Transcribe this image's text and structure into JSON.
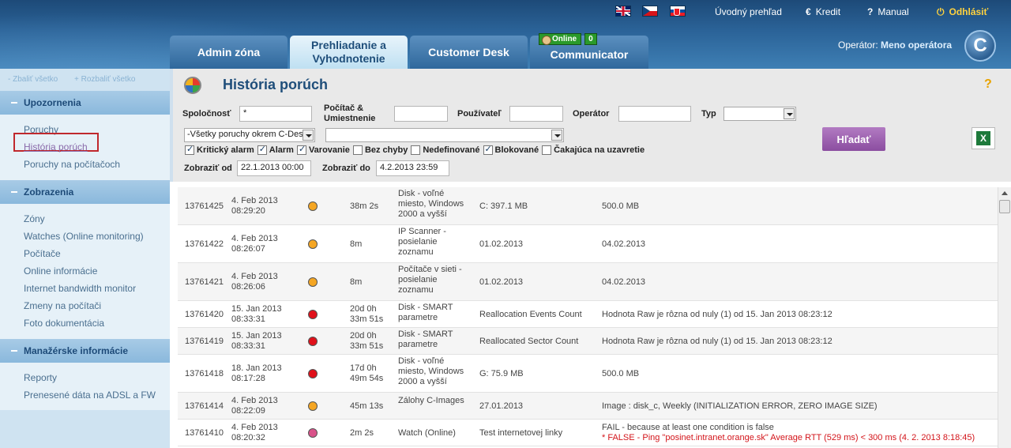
{
  "header": {
    "flags": [
      "uk-flag",
      "cz-flag",
      "sk-flag"
    ],
    "links": {
      "home": "Úvodný prehľad",
      "credit": "Kredit",
      "manual": "Manual",
      "logout": "Odhlásiť"
    },
    "tabs": [
      {
        "label": "Admin zóna"
      },
      {
        "label": "Prehliadanie a Vyhodnotenie",
        "active": true
      },
      {
        "label": "Customer Desk"
      },
      {
        "label": "Communicator"
      }
    ],
    "online": {
      "label": "Online",
      "count": "0"
    },
    "operator_label": "Operátor:",
    "operator_name": "Meno operátora",
    "logo": "C"
  },
  "sidebar": {
    "collapse_all": "- Zbaliť všetko",
    "expand_all": "+ Rozbaliť všetko",
    "sections": [
      {
        "title": "Upozornenia",
        "items": [
          "Poruchy",
          "História porúch",
          "Poruchy na počítačoch"
        ]
      },
      {
        "title": "Zobrazenia",
        "items": [
          "Zóny",
          "Watches (Online monitoring)",
          "Počítače",
          "Online informácie",
          "Internet bandwidth monitor",
          "Zmeny na počítači",
          "Foto dokumentácia"
        ]
      },
      {
        "title": "Manažérske informácie",
        "items": [
          "Reporty",
          "Prenesené dáta na ADSL a FW"
        ]
      }
    ],
    "current_item": "História porúch"
  },
  "page": {
    "title": "História porúch",
    "help": "?"
  },
  "filters": {
    "company_label": "Spoločnosť",
    "company_value": "*",
    "computer_label": "Počítač & Umiestnenie",
    "user_label": "Používateľ",
    "operator_label": "Operátor",
    "type_label": "Typ",
    "type_select": "-Všetky poruchy okrem C-Desk",
    "checkboxes": [
      {
        "label": "Kritický alarm",
        "checked": true
      },
      {
        "label": "Alarm",
        "checked": true
      },
      {
        "label": "Varovanie",
        "checked": true
      },
      {
        "label": "Bez chyby",
        "checked": false
      },
      {
        "label": "Nedefinované",
        "checked": false
      },
      {
        "label": "Blokované",
        "checked": true
      },
      {
        "label": "Čakajúca na uzavretie",
        "checked": false
      }
    ],
    "from_label": "Zobraziť od",
    "from_value": "22.1.2013 00:00",
    "to_label": "Zobraziť do",
    "to_value": "4.2.2013 23:59",
    "search_button": "Hľadať",
    "export_icon": "excel-icon"
  },
  "status_colors": {
    "orange": "#f5a623",
    "red": "#e0101a",
    "pink": "#d9528a"
  },
  "rows": [
    {
      "id": "13761425",
      "date": "4. Feb 2013",
      "time": "08:29:20",
      "status": "orange",
      "duration": "38m 2s",
      "name": "Disk - voľné miesto, Windows 2000 a vyšší",
      "value": "C: 397.1 MB",
      "limit": "500.0 MB"
    },
    {
      "id": "13761422",
      "date": "4. Feb 2013",
      "time": "08:26:07",
      "status": "orange",
      "duration": "8m",
      "name": "IP Scanner - posielanie zoznamu",
      "value": "01.02.2013",
      "limit": "04.02.2013"
    },
    {
      "id": "13761421",
      "date": "4. Feb 2013",
      "time": "08:26:06",
      "status": "orange",
      "duration": "8m",
      "name": "Počítače v sieti - posielanie zoznamu",
      "value": "01.02.2013",
      "limit": "04.02.2013"
    },
    {
      "id": "13761420",
      "date": "15. Jan 2013",
      "time": "08:33:31",
      "status": "red",
      "duration": "20d 0h 33m 51s",
      "name": "Disk - SMART parametre",
      "value": "Reallocation Events Count",
      "limit": "Hodnota Raw je rôzna od nuly (1) od 15. Jan 2013 08:23:12"
    },
    {
      "id": "13761419",
      "date": "15. Jan 2013",
      "time": "08:33:31",
      "status": "red",
      "duration": "20d 0h 33m 51s",
      "name": "Disk - SMART parametre",
      "value": "Reallocated Sector Count",
      "limit": "Hodnota Raw je rôzna od nuly (1) od 15. Jan 2013 08:23:12"
    },
    {
      "id": "13761418",
      "date": "18. Jan 2013",
      "time": "08:17:28",
      "status": "red",
      "duration": "17d 0h 49m 54s",
      "name": "Disk - voľné miesto, Windows 2000 a vyšší",
      "value": "G: 75.9 MB",
      "limit": "500.0 MB"
    },
    {
      "id": "13761414",
      "date": "4. Feb 2013",
      "time": "08:22:09",
      "status": "orange",
      "duration": "45m 13s",
      "name": "Zálohy C-Images",
      "value": "27.01.2013",
      "limit": "Image : disk_c, Weekly (INITIALIZATION ERROR, ZERO IMAGE SIZE)"
    },
    {
      "id": "13761410",
      "date": "4. Feb 2013",
      "time": "08:20:32",
      "status": "pink",
      "duration": "2m 2s",
      "name": "Watch (Online)",
      "value": "Test internetovej linky",
      "limit": "FAIL - because at least one condition is false",
      "limit_extra": "* FALSE - Ping \"posinet.intranet.orange.sk\" Average RTT (529 ms) < 300 ms (4. 2. 2013 8:18:45)"
    }
  ]
}
